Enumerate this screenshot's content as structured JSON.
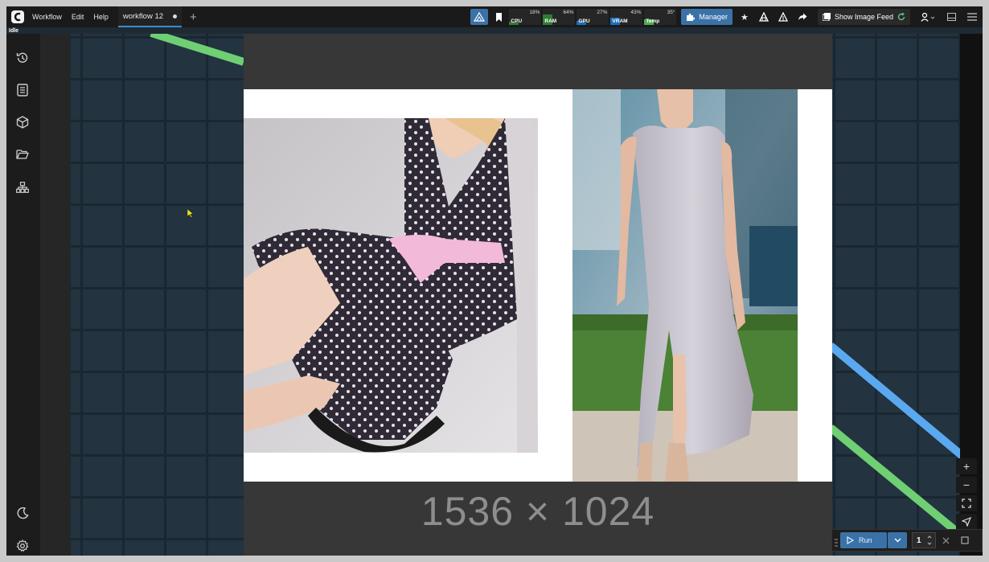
{
  "topbar": {
    "menu": [
      "Workflow",
      "Edit",
      "Help"
    ],
    "tab_title": "workflow 12",
    "meters": [
      {
        "label": "CPU",
        "value": "18%",
        "color": "#2e7d32"
      },
      {
        "label": "RAM",
        "value": "64%",
        "color": "#2e7d32"
      },
      {
        "label": "GPU",
        "value": "27%",
        "color": "#1e6fb8"
      },
      {
        "label": "VRAM",
        "value": "43%",
        "color": "#1e6fb8"
      },
      {
        "label": "Temp",
        "value": "35°",
        "color": "#4caf50"
      }
    ],
    "manager_label": "Manager",
    "feed_label": "Show Image Feed"
  },
  "status": {
    "text": "Idle"
  },
  "preview": {
    "dimensions": "1536 × 1024"
  },
  "runbar": {
    "run_label": "Run",
    "count": "1"
  },
  "colors": {
    "accent": "#3a72a8",
    "canvas": "#233340",
    "link_green": "#6fcf73",
    "link_blue": "#5aa9f0"
  }
}
